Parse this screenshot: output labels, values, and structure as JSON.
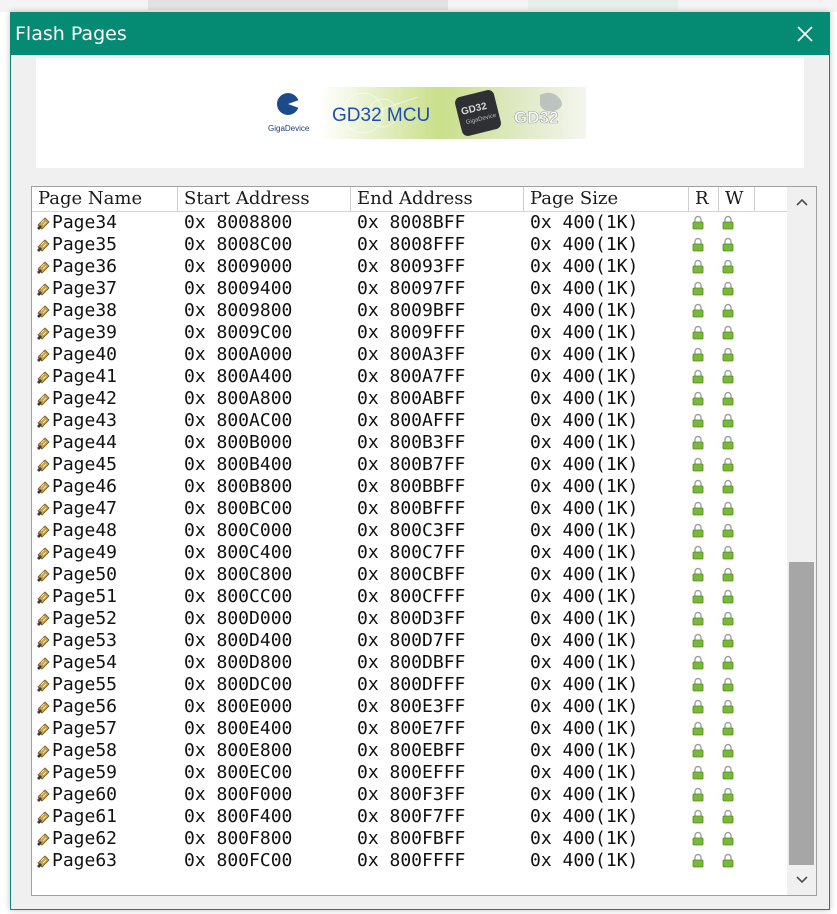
{
  "window": {
    "title": "Flash Pages"
  },
  "banner": {
    "vendor": "GigaDevice",
    "mcu_label": "GD32 MCU",
    "chip_label": "GD32",
    "chip_sub": "GigaDevice",
    "watermark": "GD32"
  },
  "table": {
    "columns": [
      "Page Name",
      "Start Address",
      "End Address",
      "Page Size",
      "R",
      "W"
    ],
    "rows": [
      {
        "name": "Page34",
        "start": "0x 8008800",
        "end": "0x 8008BFF",
        "size": "0x 400(1K)"
      },
      {
        "name": "Page35",
        "start": "0x 8008C00",
        "end": "0x 8008FFF",
        "size": "0x 400(1K)"
      },
      {
        "name": "Page36",
        "start": "0x 8009000",
        "end": "0x 80093FF",
        "size": "0x 400(1K)"
      },
      {
        "name": "Page37",
        "start": "0x 8009400",
        "end": "0x 80097FF",
        "size": "0x 400(1K)"
      },
      {
        "name": "Page38",
        "start": "0x 8009800",
        "end": "0x 8009BFF",
        "size": "0x 400(1K)"
      },
      {
        "name": "Page39",
        "start": "0x 8009C00",
        "end": "0x 8009FFF",
        "size": "0x 400(1K)"
      },
      {
        "name": "Page40",
        "start": "0x 800A000",
        "end": "0x 800A3FF",
        "size": "0x 400(1K)"
      },
      {
        "name": "Page41",
        "start": "0x 800A400",
        "end": "0x 800A7FF",
        "size": "0x 400(1K)"
      },
      {
        "name": "Page42",
        "start": "0x 800A800",
        "end": "0x 800ABFF",
        "size": "0x 400(1K)"
      },
      {
        "name": "Page43",
        "start": "0x 800AC00",
        "end": "0x 800AFFF",
        "size": "0x 400(1K)"
      },
      {
        "name": "Page44",
        "start": "0x 800B000",
        "end": "0x 800B3FF",
        "size": "0x 400(1K)"
      },
      {
        "name": "Page45",
        "start": "0x 800B400",
        "end": "0x 800B7FF",
        "size": "0x 400(1K)"
      },
      {
        "name": "Page46",
        "start": "0x 800B800",
        "end": "0x 800BBFF",
        "size": "0x 400(1K)"
      },
      {
        "name": "Page47",
        "start": "0x 800BC00",
        "end": "0x 800BFFF",
        "size": "0x 400(1K)"
      },
      {
        "name": "Page48",
        "start": "0x 800C000",
        "end": "0x 800C3FF",
        "size": "0x 400(1K)"
      },
      {
        "name": "Page49",
        "start": "0x 800C400",
        "end": "0x 800C7FF",
        "size": "0x 400(1K)"
      },
      {
        "name": "Page50",
        "start": "0x 800C800",
        "end": "0x 800CBFF",
        "size": "0x 400(1K)"
      },
      {
        "name": "Page51",
        "start": "0x 800CC00",
        "end": "0x 800CFFF",
        "size": "0x 400(1K)"
      },
      {
        "name": "Page52",
        "start": "0x 800D000",
        "end": "0x 800D3FF",
        "size": "0x 400(1K)"
      },
      {
        "name": "Page53",
        "start": "0x 800D400",
        "end": "0x 800D7FF",
        "size": "0x 400(1K)"
      },
      {
        "name": "Page54",
        "start": "0x 800D800",
        "end": "0x 800DBFF",
        "size": "0x 400(1K)"
      },
      {
        "name": "Page55",
        "start": "0x 800DC00",
        "end": "0x 800DFFF",
        "size": "0x 400(1K)"
      },
      {
        "name": "Page56",
        "start": "0x 800E000",
        "end": "0x 800E3FF",
        "size": "0x 400(1K)"
      },
      {
        "name": "Page57",
        "start": "0x 800E400",
        "end": "0x 800E7FF",
        "size": "0x 400(1K)"
      },
      {
        "name": "Page58",
        "start": "0x 800E800",
        "end": "0x 800EBFF",
        "size": "0x 400(1K)"
      },
      {
        "name": "Page59",
        "start": "0x 800EC00",
        "end": "0x 800EFFF",
        "size": "0x 400(1K)"
      },
      {
        "name": "Page60",
        "start": "0x 800F000",
        "end": "0x 800F3FF",
        "size": "0x 400(1K)"
      },
      {
        "name": "Page61",
        "start": "0x 800F400",
        "end": "0x 800F7FF",
        "size": "0x 400(1K)"
      },
      {
        "name": "Page62",
        "start": "0x 800F800",
        "end": "0x 800FBFF",
        "size": "0x 400(1K)"
      },
      {
        "name": "Page63",
        "start": "0x 800FC00",
        "end": "0x 800FFFF",
        "size": "0x 400(1K)"
      }
    ]
  },
  "icons": {
    "page": "page-icon",
    "read": "lock-icon",
    "write": "lock-icon",
    "close": "close-icon",
    "scroll_up": "chevron-up-icon",
    "scroll_down": "chevron-down-icon"
  },
  "colors": {
    "titlebar": "#058a73",
    "lock": "#7ab83a",
    "scroll_thumb": "#a6a6a6"
  },
  "scroll": {
    "position_fraction": 0.62
  }
}
